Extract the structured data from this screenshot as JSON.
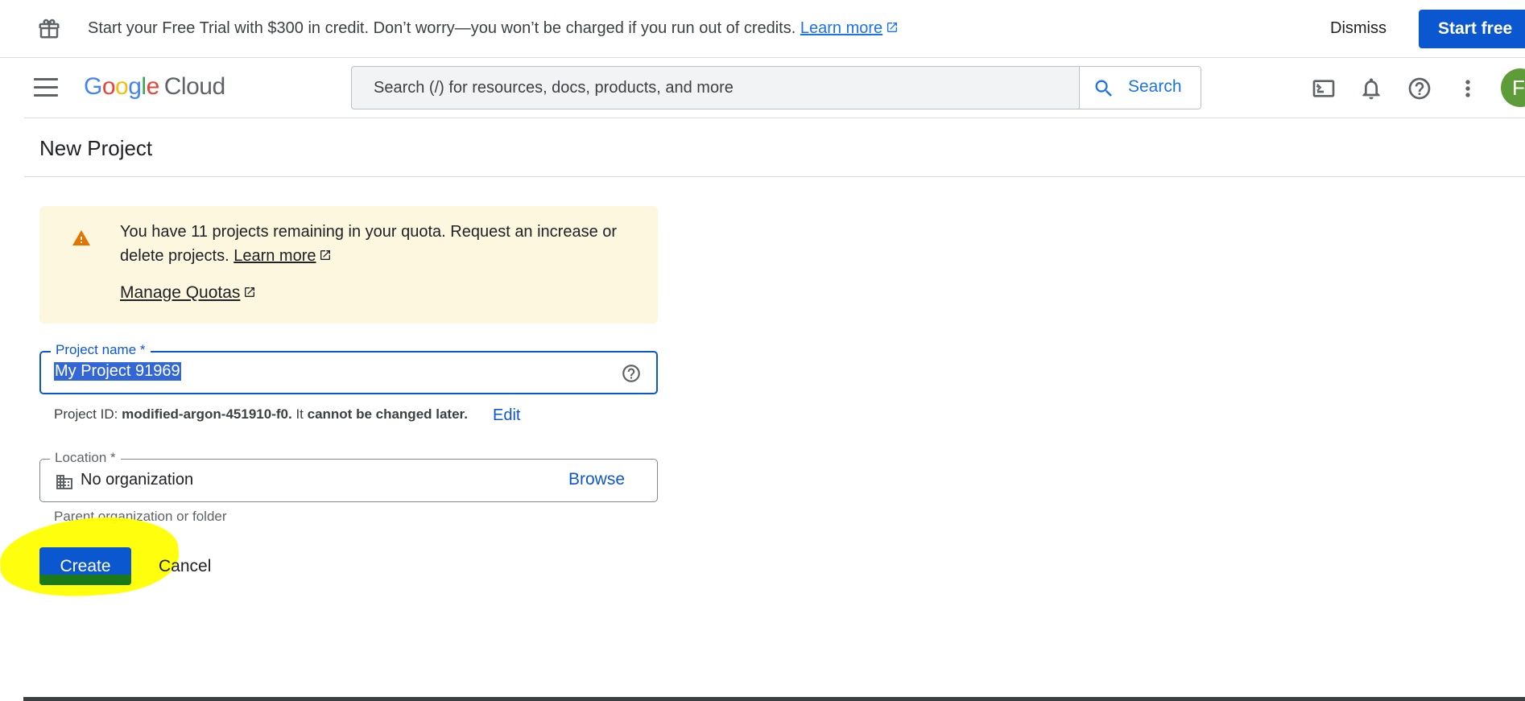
{
  "promo": {
    "text": "Start your Free Trial with $300 in credit. Don’t worry—you won’t be charged if you run out of credits.",
    "learn_more": "Learn more",
    "dismiss": "Dismiss",
    "start_free": "Start free"
  },
  "header": {
    "logo": {
      "letters": [
        "G",
        "o",
        "o",
        "g",
        "l",
        "e"
      ],
      "cloud": "Cloud"
    },
    "search_placeholder": "Search (/) for resources, docs, products, and more",
    "search_button": "Search",
    "avatar_initial": "F",
    "icons": [
      "cloud-shell-icon",
      "notifications-icon",
      "help-icon",
      "more-vert-icon"
    ]
  },
  "page": {
    "title": "New Project"
  },
  "quota_warning": {
    "text": "You have 11 projects remaining in your quota. Request an increase or delete projects.",
    "learn_more": "Learn more",
    "manage_quotas": "Manage Quotas"
  },
  "project_name": {
    "label": "Project name *",
    "value": "My Project 91969"
  },
  "project_id": {
    "prefix": "Project ID:",
    "id": "modified-argon-451910-f0.",
    "middle": "It",
    "emphasis": "cannot be changed later.",
    "edit": "Edit"
  },
  "location": {
    "label": "Location *",
    "value": "No organization",
    "browse": "Browse",
    "hint": "Parent organization or folder"
  },
  "actions": {
    "create": "Create",
    "cancel": "Cancel"
  },
  "colors": {
    "primary": "#0b57d0",
    "warning_bg": "#fef7e0",
    "warning_icon": "#e37400",
    "highlight": "#ffff00",
    "avatar": "#5e9c3a"
  }
}
